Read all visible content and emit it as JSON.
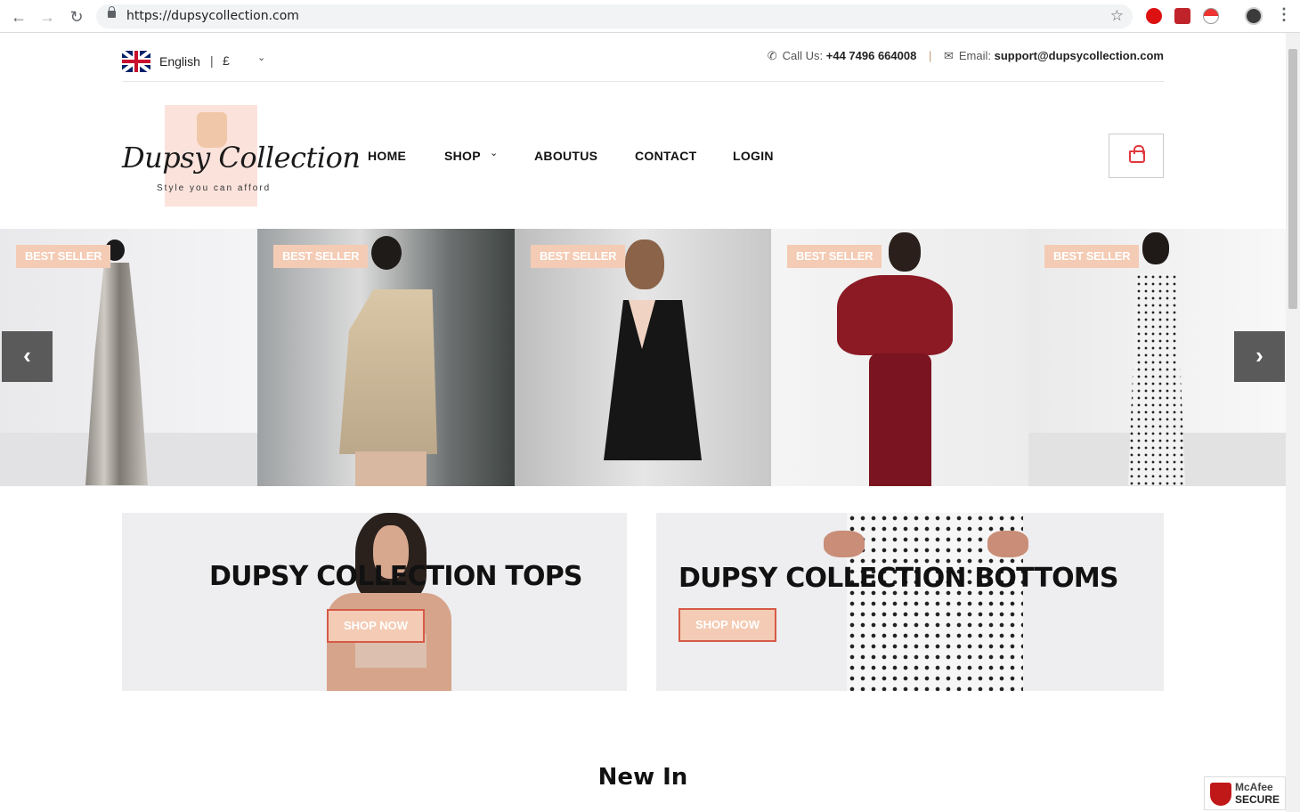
{
  "browser": {
    "url": "https://dupsycollection.com"
  },
  "topbar": {
    "language": "English",
    "currency": "£",
    "call_label": "Call Us:",
    "phone": "+44 7496 664008",
    "email_label": "Email:",
    "email": "support@dupsycollection.com"
  },
  "logo": {
    "name": "Dupsy Collection",
    "tagline": "Style you can afford"
  },
  "nav": {
    "items": [
      "HOME",
      "SHOP",
      "ABOUTUS",
      "CONTACT",
      "LOGIN"
    ]
  },
  "slider": {
    "badge": "BEST SELLER",
    "prev_icon": "chevron-left-icon",
    "next_icon": "chevron-right-icon"
  },
  "banners": [
    {
      "title": "DUPSY COLLECTION TOPS",
      "button": "SHOP NOW"
    },
    {
      "title": "DUPSY COLLECTION BOTTOMS",
      "button": "SHOP NOW"
    }
  ],
  "section": {
    "heading": "New In"
  },
  "badge_secure": {
    "line1": "McAfee",
    "line2": "SECURE"
  },
  "colors": {
    "accent_peach": "#f4cbb4",
    "accent_red": "#d65a48"
  }
}
